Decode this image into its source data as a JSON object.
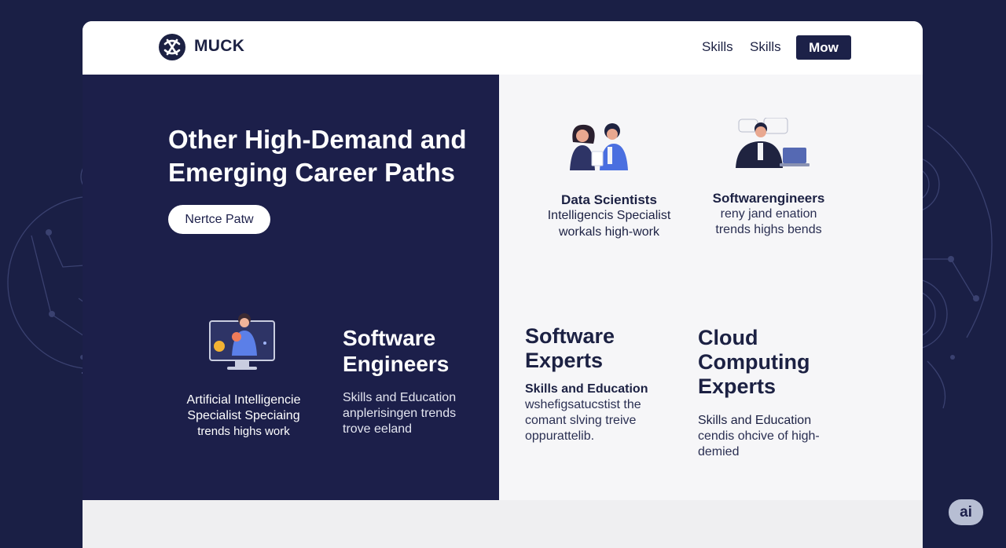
{
  "nav": {
    "brand": "MUCK",
    "links": [
      "Skills",
      "Skills"
    ],
    "cta": "Mow"
  },
  "hero": {
    "title": "Other High-Demand and Emerging Career Paths",
    "button": "Nertce Patw"
  },
  "cards": {
    "data_scientists": {
      "title": "Data Scientists",
      "line1": "Intelligencis Specialist",
      "line2": "workals high-work"
    },
    "software_engineers_top": {
      "title": "Softwarengineers",
      "line1": "reny jand enation",
      "line2": "trends highs bends"
    },
    "ai_specialist": {
      "title": "Artificial Intelligencie",
      "line1": "Specialist Speciaing",
      "line2": "trends highs work"
    },
    "software_engineers": {
      "heading1": "Software",
      "heading2": "Engineers",
      "line1": "Skills and Education",
      "line2": "anplerisingen trends",
      "line3": "trove eeland"
    },
    "software_experts": {
      "heading1": "Software",
      "heading2": "Experts",
      "subtitle": "Skills and Education",
      "line1": "wshefigsatucstist the",
      "line2": "comant slving treive",
      "line3": "oppurattelib."
    },
    "cloud_experts": {
      "heading1": "Cloud",
      "heading2": "Computing",
      "heading3": "Experts",
      "line1": "Skills and Education",
      "line2": "cendis ohcive of high-",
      "line3": "demied"
    }
  },
  "badge": "ai",
  "colors": {
    "page_bg": "#1a1f45",
    "panel_navy": "#1c1f4a",
    "panel_light": "#f6f6f8",
    "accent_blue": "#4a6fe0",
    "text_dark": "#1c2143"
  },
  "icons": [
    "logo-icon",
    "couple-illustration",
    "office-worker-illustration",
    "monitor-illustration",
    "brain-circuit-decoration"
  ]
}
